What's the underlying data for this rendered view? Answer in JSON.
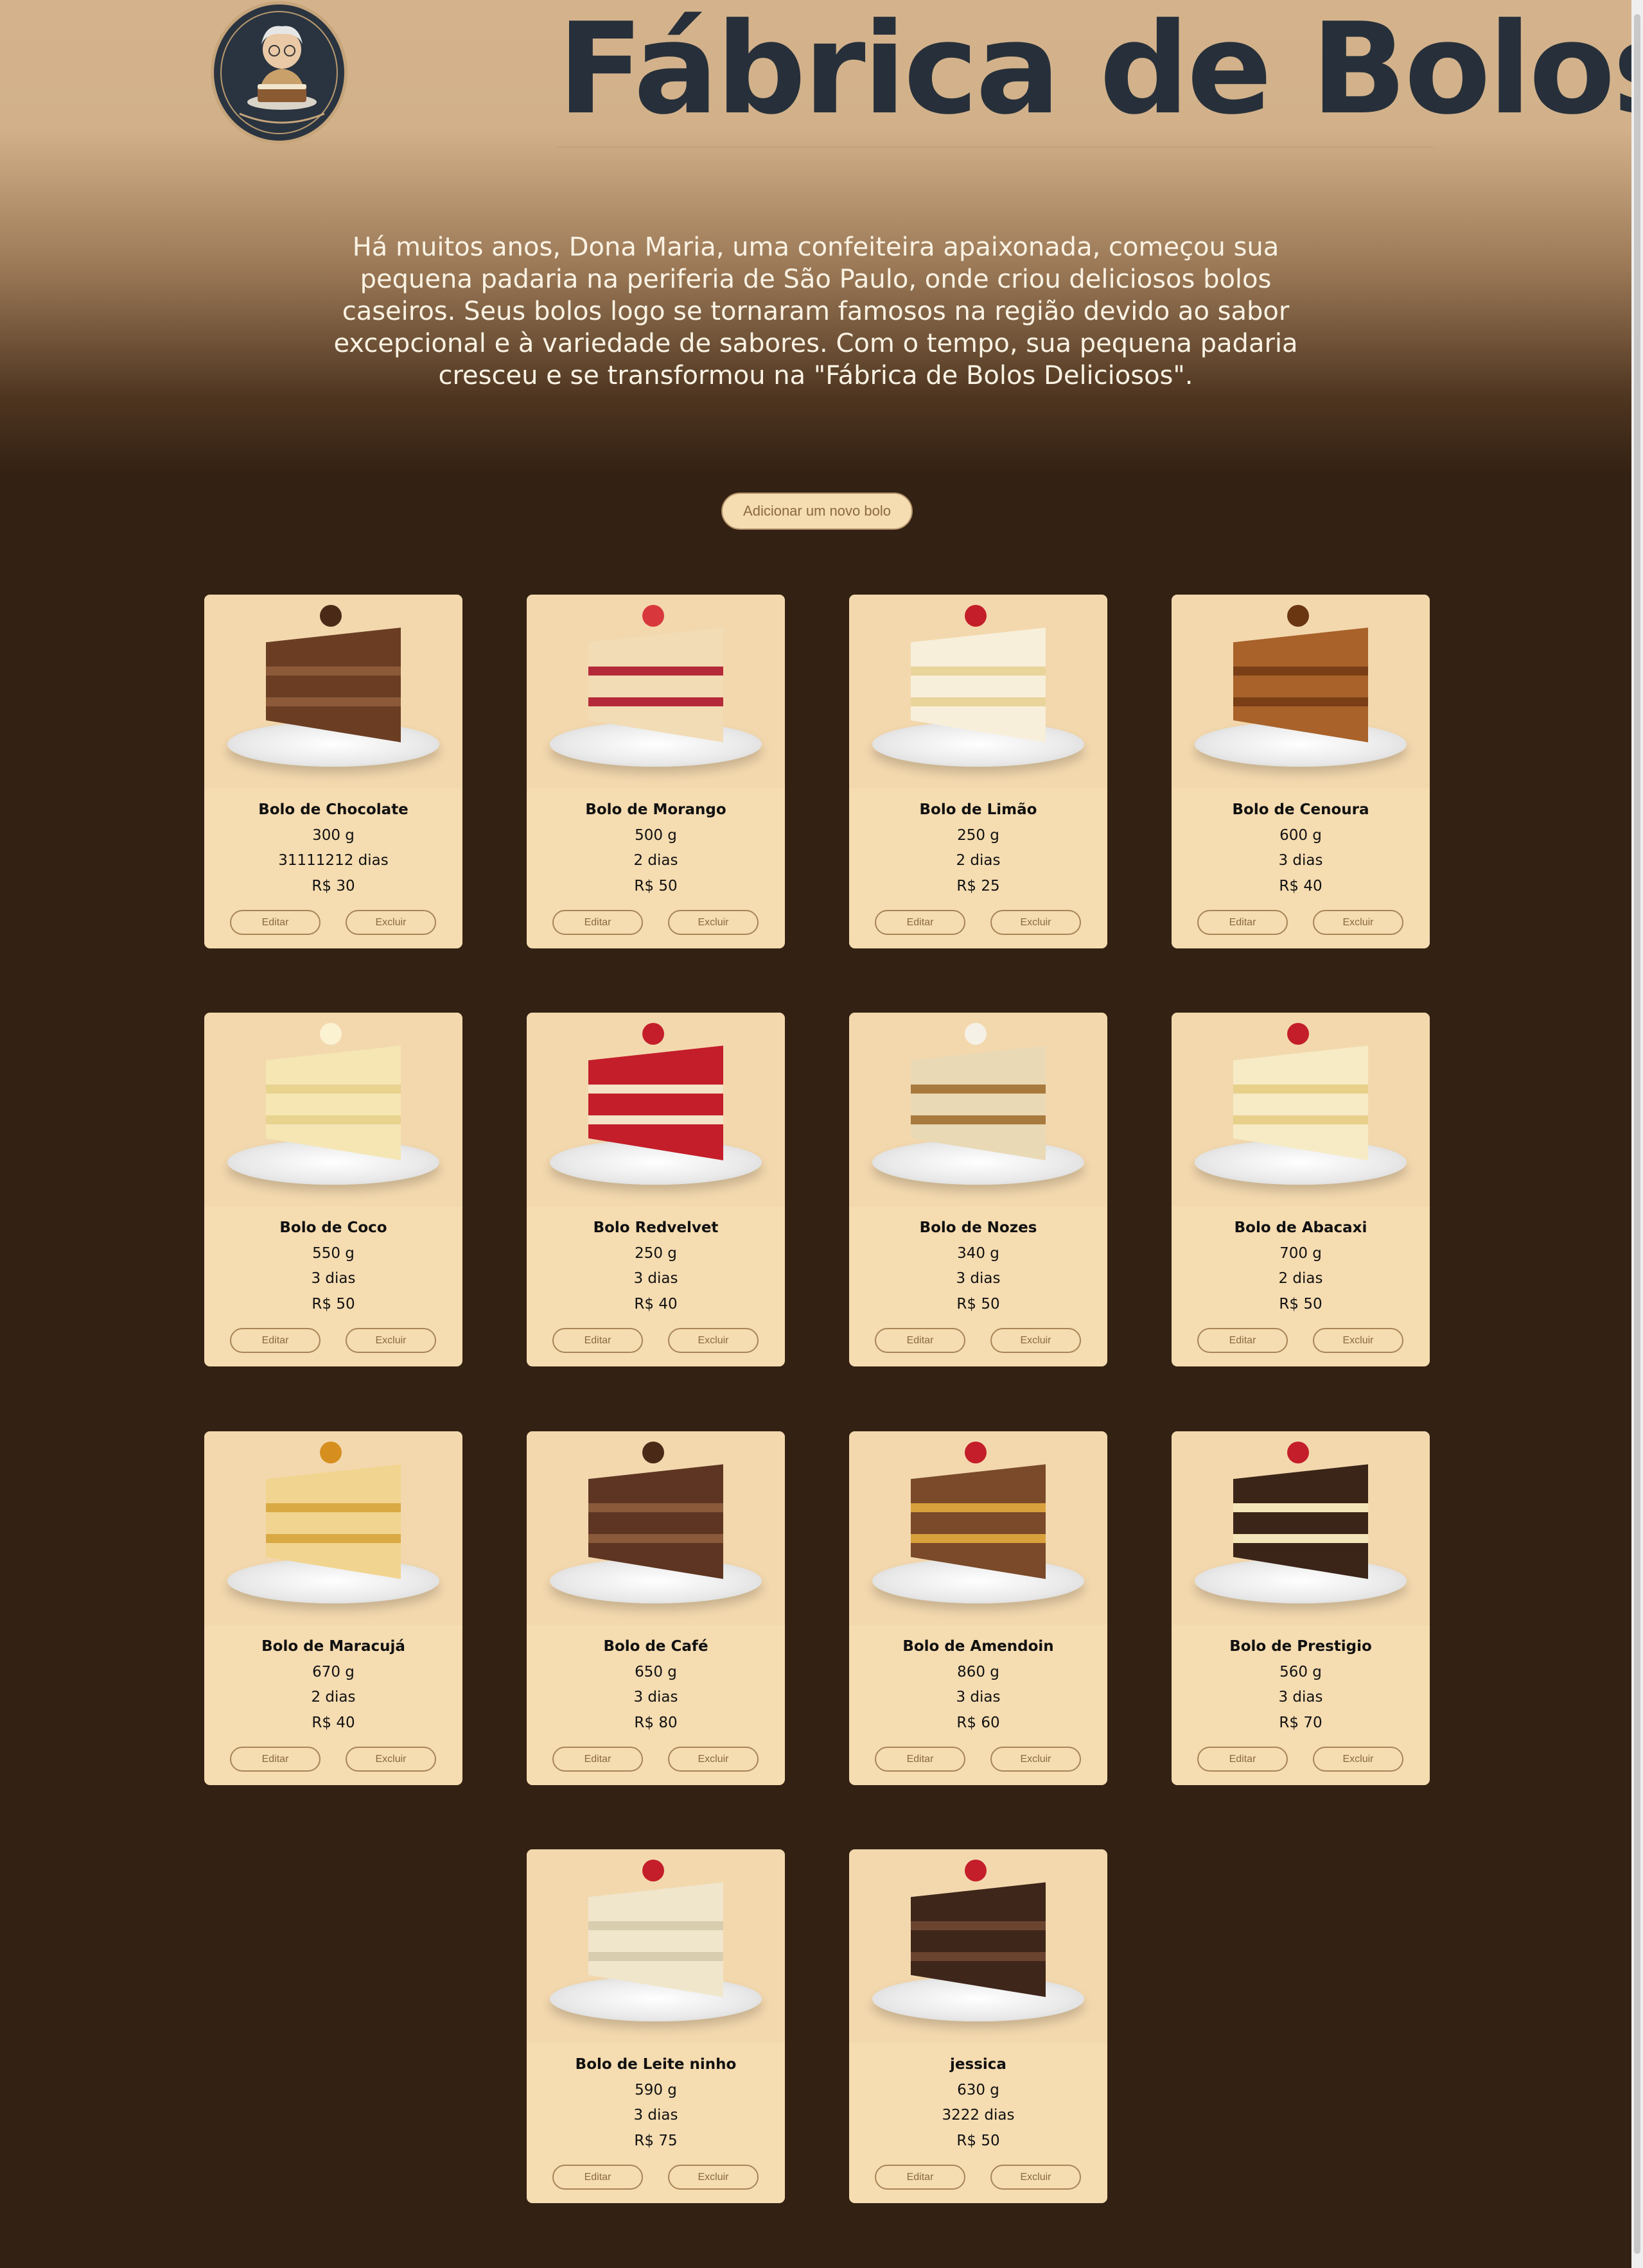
{
  "header": {
    "title": "Fábrica de Bolos",
    "logo_icon": "baker-grandma-logo-icon",
    "story": "Há muitos anos, Dona Maria, uma confeiteira apaixonada, começou sua pequena padaria na periferia de São Paulo, onde criou deliciosos bolos caseiros. Seus bolos logo se tornaram famosos na região devido ao sabor excepcional e à variedade de sabores. Com o tempo, sua pequena padaria cresceu e se transformou na \"Fábrica de Bolos Deliciosos\"."
  },
  "add_button_label": "Adicionar um novo bolo",
  "labels": {
    "edit": "Editar",
    "delete": "Excluir"
  },
  "colors": {
    "background": "#332113",
    "card": "#f5dcb1",
    "accent": "#8a6a3e",
    "title": "#27303a"
  },
  "cakes": [
    {
      "name": "Bolo de Chocolate",
      "weight": "300 g",
      "validity": "31111212 dias",
      "price": "R$ 30",
      "cake_color": "#6b3e24",
      "layer_color": "#8d5a39",
      "topper_color": "#4a2a17"
    },
    {
      "name": "Bolo de Morango",
      "weight": "500 g",
      "validity": "2 dias",
      "price": "R$ 50",
      "cake_color": "#f1dcb6",
      "layer_color": "#b52a3a",
      "topper_color": "#d8383c"
    },
    {
      "name": "Bolo de Limão",
      "weight": "250 g",
      "validity": "2 dias",
      "price": "R$ 25",
      "cake_color": "#f7efd9",
      "layer_color": "#e9d49a",
      "topper_color": "#c41e2a"
    },
    {
      "name": "Bolo de Cenoura",
      "weight": "600 g",
      "validity": "3 dias",
      "price": "R$ 40",
      "cake_color": "#a8622a",
      "layer_color": "#7a3f17",
      "topper_color": "#6a3612"
    },
    {
      "name": "Bolo de Coco",
      "weight": "550 g",
      "validity": "3 dias",
      "price": "R$ 50",
      "cake_color": "#f5e6b4",
      "layer_color": "#e8d38f",
      "topper_color": "#fbf2d2"
    },
    {
      "name": "Bolo Redvelvet",
      "weight": "250 g",
      "validity": "3 dias",
      "price": "R$ 40",
      "cake_color": "#c41e2a",
      "layer_color": "#f4e3c6",
      "topper_color": "#c41e2a"
    },
    {
      "name": "Bolo de Nozes",
      "weight": "340 g",
      "validity": "3 dias",
      "price": "R$ 50",
      "cake_color": "#e9d9b5",
      "layer_color": "#a87a3e",
      "topper_color": "#f6f1e6"
    },
    {
      "name": "Bolo de Abacaxi",
      "weight": "700 g",
      "validity": "2 dias",
      "price": "R$ 50",
      "cake_color": "#f6ebc4",
      "layer_color": "#e8d08a",
      "topper_color": "#c41e2a"
    },
    {
      "name": "Bolo de Maracujá",
      "weight": "670 g",
      "validity": "2 dias",
      "price": "R$ 40",
      "cake_color": "#f1d48f",
      "layer_color": "#d9a944",
      "topper_color": "#d68f1f"
    },
    {
      "name": "Bolo de Café",
      "weight": "650 g",
      "validity": "3 dias",
      "price": "R$ 80",
      "cake_color": "#5e3522",
      "layer_color": "#8a5a3b",
      "topper_color": "#4a2a17"
    },
    {
      "name": "Bolo de Amendoin",
      "weight": "860 g",
      "validity": "3 dias",
      "price": "R$ 60",
      "cake_color": "#7a4a2a",
      "layer_color": "#d9a13b",
      "topper_color": "#c41e2a"
    },
    {
      "name": "Bolo de Prestigio",
      "weight": "560 g",
      "validity": "3 dias",
      "price": "R$ 70",
      "cake_color": "#3b2518",
      "layer_color": "#f4e6b8",
      "topper_color": "#c41e2a"
    },
    {
      "name": "Bolo de Leite ninho",
      "weight": "590 g",
      "validity": "3 dias",
      "price": "R$ 75",
      "cake_color": "#f0e6cc",
      "layer_color": "#d9cdb0",
      "topper_color": "#c41e2a"
    },
    {
      "name": "jessica",
      "weight": "630 g",
      "validity": "3222 dias",
      "price": "R$ 50",
      "cake_color": "#3f261a",
      "layer_color": "#6b4430",
      "topper_color": "#c41e2a"
    }
  ]
}
